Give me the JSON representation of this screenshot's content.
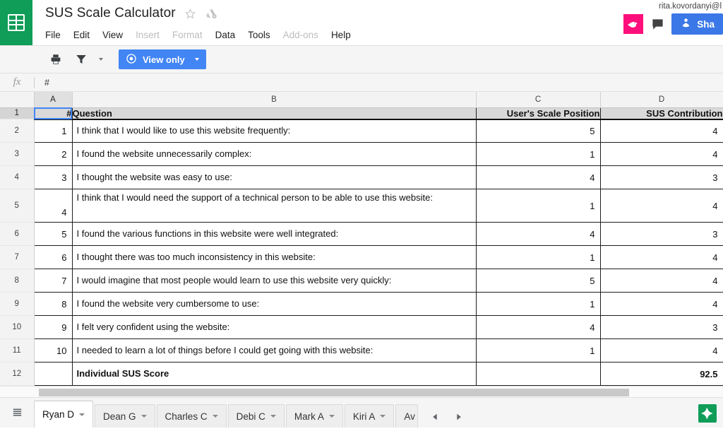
{
  "app": {
    "logo_icon": "sheets-grid-icon",
    "doc_title": "SUS Scale Calculator",
    "star_icon": "star-outline-icon",
    "drive_icon": "drive-move-icon"
  },
  "menu": {
    "items": [
      {
        "label": "File",
        "disabled": false
      },
      {
        "label": "Edit",
        "disabled": false
      },
      {
        "label": "View",
        "disabled": false
      },
      {
        "label": "Insert",
        "disabled": true
      },
      {
        "label": "Format",
        "disabled": true
      },
      {
        "label": "Data",
        "disabled": false
      },
      {
        "label": "Tools",
        "disabled": false
      },
      {
        "label": "Add-ons",
        "disabled": true
      },
      {
        "label": "Help",
        "disabled": false
      }
    ]
  },
  "account": {
    "email": "rita.kovordanyi@l",
    "bird_icon": "bird-icon",
    "comment_icon": "comment-bubble-icon",
    "share_label": "Sha",
    "share_icon": "share-person-lock-icon"
  },
  "toolbar": {
    "print_icon": "printer-icon",
    "filter_icon": "filter-funnel-icon",
    "view_mode_label": "View only",
    "view_mode_icon": "eye-icon"
  },
  "formula_bar": {
    "fx_label": "fx",
    "value": "#"
  },
  "grid": {
    "column_headers": [
      "A",
      "B",
      "C",
      "D"
    ],
    "active_column": "A",
    "active_row": "1",
    "selected_cell": "A1",
    "row_numbers": [
      "1",
      "2",
      "3",
      "4",
      "5",
      "6",
      "7",
      "8",
      "9",
      "10",
      "11",
      "12"
    ],
    "header_row": {
      "a": "#",
      "b": "Question",
      "c": "User's Scale Position",
      "d": "SUS Contribution"
    },
    "rows": [
      {
        "a": "1",
        "b": "I think that I would like to use this website frequently:",
        "c": "5",
        "d": "4"
      },
      {
        "a": "2",
        "b": "I found the website unnecessarily complex:",
        "c": "1",
        "d": "4"
      },
      {
        "a": "3",
        "b": "I thought the website was easy to use:",
        "c": "4",
        "d": "3"
      },
      {
        "a": "4",
        "b": "I think that I would need the support of a technical person to be able to use this website:",
        "c": "1",
        "d": "4"
      },
      {
        "a": "5",
        "b": "I found the various functions in this website were well integrated:",
        "c": "4",
        "d": "3"
      },
      {
        "a": "6",
        "b": "I thought there was too much inconsistency in this website:",
        "c": "1",
        "d": "4"
      },
      {
        "a": "7",
        "b": "I would imagine that most people would learn to use this website very quickly:",
        "c": "5",
        "d": "4"
      },
      {
        "a": "8",
        "b": "I found the website very cumbersome to use:",
        "c": "1",
        "d": "4"
      },
      {
        "a": "9",
        "b": "I felt very confident using the website:",
        "c": "4",
        "d": "3"
      },
      {
        "a": "10",
        "b": "I needed to learn a lot of things before I could get going with this website:",
        "c": "1",
        "d": "4"
      }
    ],
    "total_row": {
      "a": "",
      "b": "Individual SUS Score",
      "c": "",
      "d": "92.5"
    }
  },
  "sheet_tabs": {
    "all_sheets_icon": "all-sheets-icon",
    "tabs": [
      {
        "label": "Ryan D",
        "active": true
      },
      {
        "label": "Dean G",
        "active": false
      },
      {
        "label": "Charles C",
        "active": false
      },
      {
        "label": "Debi C",
        "active": false
      },
      {
        "label": "Mark A",
        "active": false
      },
      {
        "label": "Kiri A",
        "active": false
      },
      {
        "label": "Av",
        "active": false
      }
    ],
    "prev_icon": "arrow-left-icon",
    "next_icon": "arrow-right-icon",
    "explore_icon": "explore-sparkle-icon"
  },
  "colors": {
    "brand_green": "#0f9d58",
    "accent_blue": "#4285f4",
    "share_blue": "#3b78e7",
    "alert_red": "#e8000d",
    "bird_pink": "#ff0f7b"
  }
}
